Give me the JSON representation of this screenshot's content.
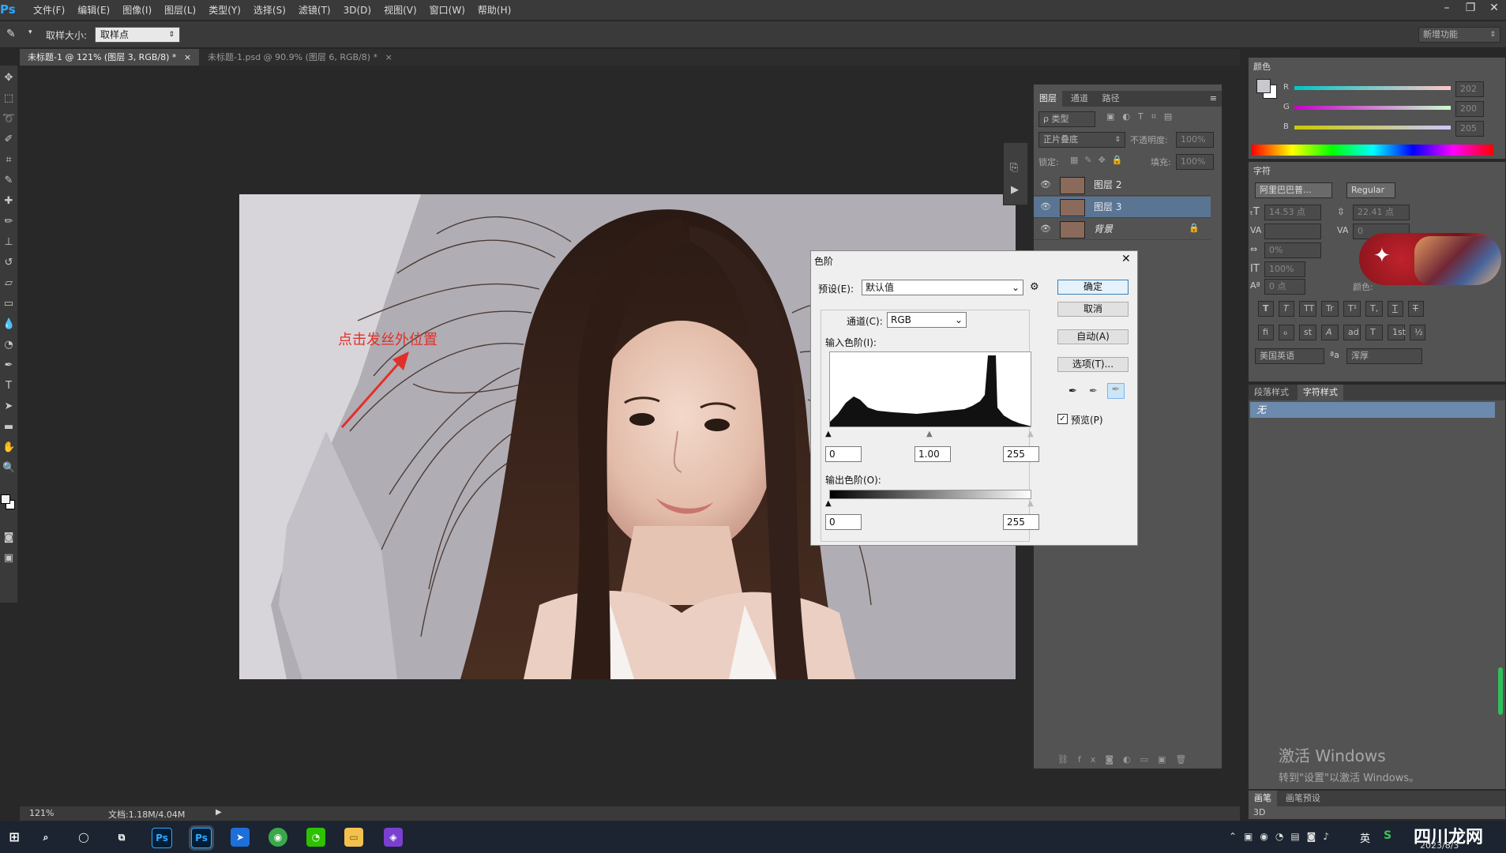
{
  "app": {
    "logo": "Ps",
    "menus": [
      "文件(F)",
      "编辑(E)",
      "图像(I)",
      "图层(L)",
      "类型(Y)",
      "选择(S)",
      "滤镜(T)",
      "3D(D)",
      "视图(V)",
      "窗口(W)",
      "帮助(H)"
    ],
    "win_controls": [
      "–",
      "❐",
      "✕"
    ]
  },
  "options": {
    "sample_label": "取样大小:",
    "sample_value": "取样点",
    "workspace": "新增功能"
  },
  "tabs": [
    {
      "label": "未标题-1 @ 121% (图层 3, RGB/8) *",
      "close": "×"
    },
    {
      "label": "未标题-1.psd @ 90.9% (图层 6, RGB/8) *",
      "close": "×"
    }
  ],
  "annotation": "点击发丝外位置",
  "layers_panel": {
    "tabs": [
      "图层",
      "通道",
      "路径"
    ],
    "filter": "ρ 类型",
    "blend": "正片叠底",
    "opacity_label": "不透明度:",
    "opacity_value": "100%",
    "lock_label": "锁定:",
    "fill_label": "填充:",
    "fill_value": "100%",
    "layers": [
      {
        "name": "图层 2",
        "selected": false
      },
      {
        "name": "图层 3",
        "selected": true
      },
      {
        "name": "背景",
        "selected": false
      }
    ]
  },
  "dialog": {
    "title": "色阶",
    "close": "✕",
    "preset_label": "预设(E):",
    "preset_value": "默认值",
    "channel_label": "通道(C):",
    "channel_value": "RGB",
    "input_label": "输入色阶(I):",
    "input_values": [
      "0",
      "1.00",
      "255"
    ],
    "output_label": "输出色阶(O):",
    "output_values": [
      "0",
      "255"
    ],
    "buttons": {
      "ok": "确定",
      "cancel": "取消",
      "auto": "自动(A)",
      "options": "选项(T)..."
    },
    "preview_label": "预览(P)",
    "preview_checked": true
  },
  "color_panel": {
    "title": "颜色",
    "r_label": "R",
    "g_label": "G",
    "b_label": "B",
    "r": "202",
    "g": "200",
    "b": "205"
  },
  "char_panel": {
    "title": "字符",
    "font": "阿里巴巴普...",
    "style": "Regular",
    "size": "14.53 点",
    "leading": "22.41 点",
    "tracking": "0",
    "scale_pct": "0%",
    "vscale": "100%",
    "baseline": "0 点",
    "color_label": "颜色:",
    "language": "美国英语",
    "aa_label": "ªa",
    "aa_value": "浑厚",
    "glyphs1": [
      "T",
      "T",
      "TT",
      "Tr",
      "T¹",
      "T,",
      "T",
      "T"
    ],
    "glyphs2": [
      "fi",
      "ℴ",
      "st",
      "A",
      "ad",
      "T",
      "1st",
      "½"
    ]
  },
  "styles_panel": {
    "tabs": [
      "段落样式",
      "字符样式"
    ],
    "item": "无"
  },
  "brush_panel": {
    "tabs": [
      "画笔",
      "画笔预设"
    ],
    "tab3d": "3D"
  },
  "watermark": {
    "line1": "激活 Windows",
    "line2": "转到\"设置\"以激活 Windows。"
  },
  "status": {
    "zoom": "121%",
    "doc": "文档:1.18M/4.04M"
  },
  "taskbar": {
    "date": "2023/8/3",
    "ime": "英",
    "site": "四川龙网"
  },
  "colors": {
    "accent": "#31a8ff",
    "selected_layer": "#5a7594",
    "arrow": "#e0302a"
  }
}
